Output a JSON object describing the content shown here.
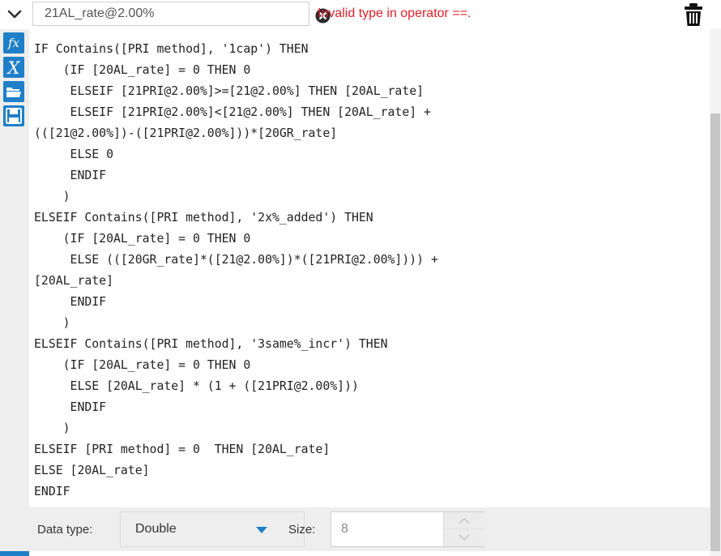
{
  "header": {
    "field_name": "21AL_rate@2.00%",
    "error_message": "Invalid type in operator ==."
  },
  "icons": {
    "collapse": "chevron-down-icon",
    "error": "error-x-circle-icon",
    "delete": "trash-icon",
    "functions": "fx-icon",
    "variables": "variable-x-icon",
    "open": "folder-open-icon",
    "save": "save-disk-icon"
  },
  "left_bar": {
    "fx_label": "fx",
    "var_label": "X"
  },
  "editor": {
    "lines": [
      "IF Contains([PRI method], '1cap') THEN",
      "    (IF [20AL_rate] = 0 THEN 0",
      "     ELSEIF [21PRI@2.00%]>=[21@2.00%] THEN [20AL_rate]",
      "     ELSEIF [21PRI@2.00%]<[21@2.00%] THEN [20AL_rate] +",
      "(([21@2.00%])-([21PRI@2.00%]))*[20GR_rate]",
      "     ELSE 0",
      "     ENDIF",
      "    )",
      "ELSEIF Contains([PRI method], '2x%_added') THEN",
      "    (IF [20AL_rate] = 0 THEN 0",
      "     ELSE (([20GR_rate]*([21@2.00%])*([21PRI@2.00%]))) +",
      "[20AL_rate]",
      "     ENDIF",
      "    )",
      "ELSEIF Contains([PRI method], '3same%_incr') THEN",
      "    (IF [20AL_rate] = 0 THEN 0",
      "     ELSE [20AL_rate] * (1 + ([21PRI@2.00%]))",
      "     ENDIF",
      "    )",
      "ELSEIF [PRI method] = 0  THEN [20AL_rate]",
      "ELSE [20AL_rate]",
      "ENDIF"
    ]
  },
  "footer": {
    "data_type_label": "Data type:",
    "data_type_value": "Double",
    "size_label": "Size:",
    "size_value": "8"
  },
  "colors": {
    "accent": "#1f7fc8",
    "error": "#e0212a"
  }
}
